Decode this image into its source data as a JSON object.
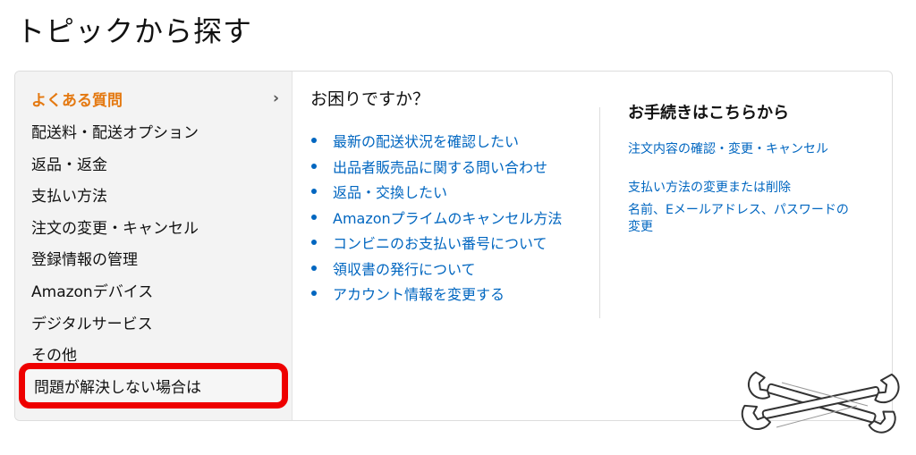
{
  "page": {
    "title": "トピックから探す"
  },
  "sidebar": {
    "items": [
      {
        "label": "よくある質問",
        "active": true
      },
      {
        "label": "配送料・配送オプション"
      },
      {
        "label": "返品・返金"
      },
      {
        "label": "支払い方法"
      },
      {
        "label": "注文の変更・キャンセル"
      },
      {
        "label": "登録情報の管理"
      },
      {
        "label": "Amazonデバイス"
      },
      {
        "label": "デジタルサービス"
      },
      {
        "label": "その他"
      },
      {
        "label": "問題が解決しない場合は",
        "highlighted": true
      }
    ],
    "chevron": "›"
  },
  "faq": {
    "heading": "お困りですか？",
    "links": [
      "最新の配送状況を確認したい",
      "出品者販売品に関する問い合わせ",
      "返品・交換したい",
      "Amazonプライムのキャンセル方法",
      "コンビニのお支払い番号について",
      "領収書の発行について",
      "アカウント情報を変更する"
    ]
  },
  "procedures": {
    "heading": "お手続きはこちらから",
    "links": [
      "注文内容の確認・変更・キャンセル",
      "支払い方法の変更または削除",
      "名前、Eメールアドレス、パスワードの変更"
    ]
  },
  "icons": {
    "illustration": "wrenches-icon"
  },
  "colors": {
    "active_orange": "#e47911",
    "link_blue": "#0066c0",
    "highlight_red": "#ee0000",
    "sidebar_bg": "#f3f3f3"
  }
}
